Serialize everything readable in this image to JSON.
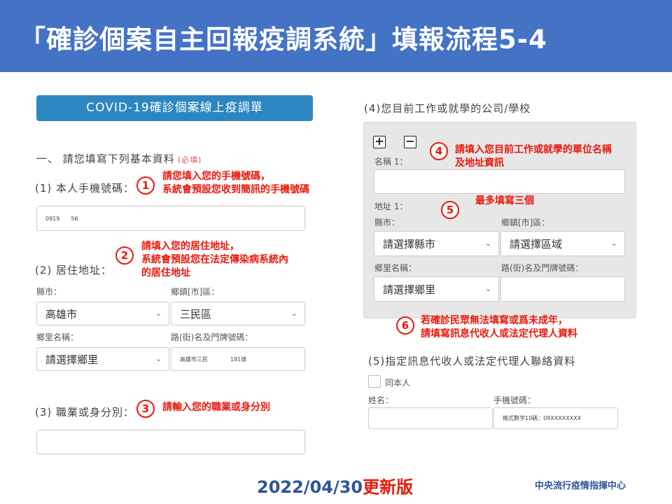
{
  "slide_title": "「確診個案自主回報疫調系統」填報流程5-4",
  "form_header": "COVID-19確診個案線上疫調單",
  "section1": {
    "title": "一、 請您填寫下列基本資料",
    "required": "(必填)"
  },
  "phone": {
    "label": "(1) 本人手機號碼：",
    "value": "0919　　56"
  },
  "address": {
    "label": "(2) 居住地址：",
    "county_label": "縣市：",
    "county_value": "高雄市",
    "district_label": "鄉鎮[市]區：",
    "district_value": "三民區",
    "village_label": "鄉里名稱：",
    "village_value": "請選擇鄉里",
    "road_label": "路(街)名及門牌號碼：",
    "road_value": "高雄市三民　　　　181號"
  },
  "occupation": {
    "label": "(3) 職業或身分別：",
    "value": ""
  },
  "work": {
    "label": "(4)您目前工作或就學的公司/學校",
    "plus": "+",
    "minus": "−",
    "name_label": "名稱 1：",
    "name_value": "",
    "addr_label": "地址 1：",
    "county_label": "縣市：",
    "county_value": "請選擇縣市",
    "district_label": "鄉鎮[市]區：",
    "district_value": "請選擇區域",
    "village_label": "鄉里名稱：",
    "village_value": "請選擇鄉里",
    "road_label": "路(街)名及門牌號碼：",
    "road_value": ""
  },
  "proxy": {
    "label": "(5)指定訊息代收人或法定代理人聯絡資料",
    "same_label": "同本人",
    "name_label": "姓名：",
    "name_value": "",
    "phone_label": "手機號碼：",
    "phone_placeholder": "格式數字10碼：09XXXXXXXX"
  },
  "annotations": {
    "a1": {
      "num": "1",
      "l1": "請您填入您的手機號碼，",
      "l2": "系統會預設您收到簡訊的手機號碼"
    },
    "a2": {
      "num": "2",
      "l1": "請填入您的居住地址，",
      "l2": "系統會預設您在法定傳染病系統內",
      "l3": "的居住地址"
    },
    "a3": {
      "num": "3",
      "l1": "請輸入您的職業或身分別"
    },
    "a4": {
      "num": "4",
      "l1": "請填入您目前工作或就學的單位名稱",
      "l2": "及地址資訊"
    },
    "a5": {
      "num": "5",
      "l1": "最多填寫三個"
    },
    "a6": {
      "num": "6",
      "l1": "若確診民眾無法填寫或爲未成年，",
      "l2": "請填寫訊息代收人或法定代理人資料"
    }
  },
  "footer": {
    "date": "2022/04/30",
    "update": "更新版",
    "org": "中央流行疫情指揮中心"
  },
  "icons": {
    "chevron": "chevron-down-icon"
  },
  "colors": {
    "title_bg": "#4472c4",
    "header_bg": "#2e86c1",
    "annotation_red": "#e8190d",
    "footer_blue": "#2f5597"
  }
}
